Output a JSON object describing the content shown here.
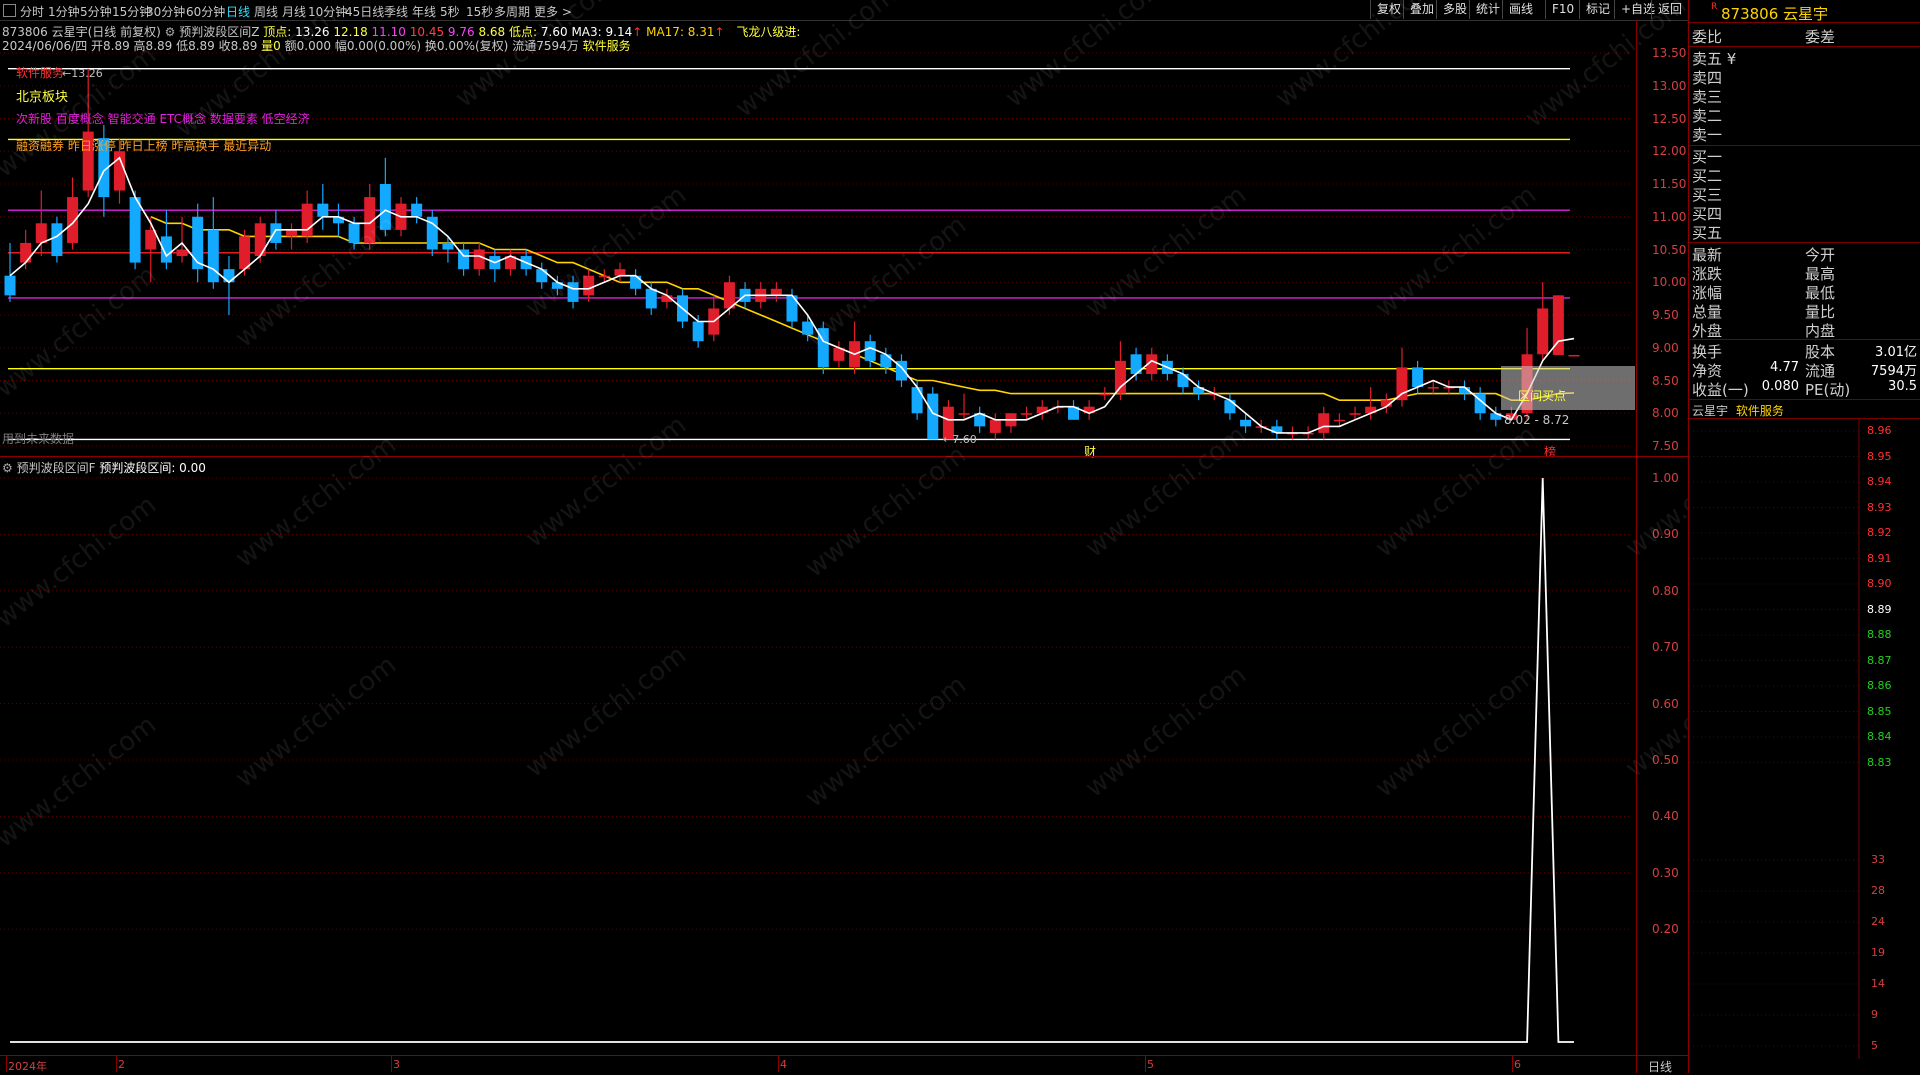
{
  "toolbar": {
    "timeframes": [
      "分时",
      "1分钟",
      "5分钟",
      "15分钟",
      "30分钟",
      "60分钟",
      "日线",
      "周线",
      "月线",
      "10分钟",
      "45日线",
      "季线",
      "年线",
      "5秒",
      "15秒",
      "多周期",
      "更多 >"
    ],
    "active": "日线",
    "right_buttons": [
      "复权",
      "叠加",
      "多股",
      "统计",
      "画线",
      "F10",
      "标记",
      "+自选",
      "返回"
    ]
  },
  "stock": {
    "code": "873806",
    "name": "云星宇",
    "title_line": "873806 云星宇(日线 前复权)",
    "indicator_name": "预判波段区间Z",
    "peak_label": "顶点:",
    "peak_values": [
      "13.26",
      "12.18",
      "11.10",
      "10.45",
      "9.76",
      "8.68"
    ],
    "low_label": "低点:",
    "low_value": "7.60",
    "ma3": "MA3: 9.14",
    "ma17": "MA17: 8.31",
    "flag": "飞龙八级进:",
    "date_line": "2024/06/06/四 开8.89 高8.89 低8.89 收8.89",
    "vol_label": "量0",
    "amount": "额0.000",
    "amp": "幅0.00(0.00%)",
    "turnover": "换0.00%(复权)",
    "float": "流通7594万",
    "sector": "软件服务"
  },
  "annotations": {
    "software": "软件服务",
    "peak_marker": "13.26",
    "beijing": "北京板块",
    "concepts": "次新股 百度概念 智能交通 ETC概念 数据要素 低空经济",
    "news": "融资融券 昨日涨停 昨日上榜 昨高换手 最近异动",
    "low_marker": "7.60",
    "buy_zone": "区间买点",
    "range_text": "8.02 - 8.72",
    "future": "用到未来数据",
    "cai": "财",
    "bang": "榜"
  },
  "sub_indicator": {
    "title": "预判波段区间F",
    "label": "预判波段区间: 0.00"
  },
  "date_axis": [
    "2024年",
    "2",
    "3",
    "4",
    "5",
    "6"
  ],
  "period_label": "日线",
  "right_panel": {
    "header_flag": "R",
    "header": "873806 云星宇",
    "weibi": "委比",
    "weicha": "委差",
    "asks": [
      "卖五 ¥",
      "卖四",
      "卖三",
      "卖二",
      "卖一"
    ],
    "bids": [
      "买一",
      "买二",
      "买三",
      "买四",
      "买五"
    ],
    "stats_left": [
      "最新",
      "涨跌",
      "涨幅",
      "总量",
      "外盘"
    ],
    "stats_right": [
      "今开",
      "最高",
      "最低",
      "量比",
      "内盘"
    ],
    "fund": [
      {
        "label": "换手",
        "label2": "股本",
        "value2": "3.01亿"
      },
      {
        "label": "净资",
        "value": "4.77",
        "label2": "流通",
        "value2": "7594万"
      },
      {
        "label": "收益(一)",
        "value": "0.080",
        "label2": "PE(动)",
        "value2": "30.5"
      }
    ],
    "mini_title": "云星宇",
    "mini_sector": "软件服务",
    "mini_prices": [
      "8.96",
      "8.95",
      "8.94",
      "8.93",
      "8.92",
      "8.91",
      "8.90",
      "8.89",
      "8.88",
      "8.87",
      "8.86",
      "8.85",
      "8.84",
      "8.83"
    ],
    "mini_vols": [
      "33",
      "28",
      "24",
      "19",
      "14",
      "9",
      "5"
    ]
  },
  "watermark": "www.cfchi.com",
  "colors": {
    "up": "#e01e2b",
    "down": "#12a9ff",
    "ma3": "#ffffff",
    "ma17": "#ffd400",
    "price_axis": "#d24040",
    "magenta": "#e020e0",
    "yellow": "#ffff00",
    "red_line": "#ff3030"
  },
  "chart_data": {
    "type": "candlestick",
    "y_axis_labels": [
      "13.50",
      "13.00",
      "12.50",
      "12.00",
      "11.50",
      "11.00",
      "10.50",
      "10.00",
      "9.50",
      "9.00",
      "8.50",
      "8.00",
      "7.50"
    ],
    "ylim": [
      7.35,
      13.6
    ],
    "horizontal_levels": [
      {
        "value": 13.26,
        "color": "white"
      },
      {
        "value": 12.18,
        "color": "yellow"
      },
      {
        "value": 11.1,
        "color": "magenta"
      },
      {
        "value": 10.45,
        "color": "red"
      },
      {
        "value": 9.76,
        "color": "magenta"
      },
      {
        "value": 8.68,
        "color": "yellow"
      },
      {
        "value": 7.6,
        "color": "white"
      }
    ],
    "candles": [
      [
        10.1,
        9.8,
        10.6,
        9.7
      ],
      [
        10.3,
        10.6,
        10.8,
        10.2
      ],
      [
        10.6,
        10.9,
        11.4,
        10.4
      ],
      [
        10.9,
        10.4,
        11.0,
        10.3
      ],
      [
        10.6,
        11.3,
        11.6,
        10.5
      ],
      [
        11.4,
        12.3,
        13.26,
        11.3
      ],
      [
        12.2,
        11.3,
        12.4,
        11.0
      ],
      [
        11.4,
        12.0,
        12.2,
        11.2
      ],
      [
        11.3,
        10.3,
        11.4,
        10.2
      ],
      [
        10.5,
        10.8,
        11.0,
        10.0
      ],
      [
        10.7,
        10.3,
        11.1,
        10.2
      ],
      [
        10.4,
        10.5,
        11.0,
        10.3
      ],
      [
        11.0,
        10.2,
        11.2,
        10.0
      ],
      [
        10.8,
        10.0,
        11.3,
        9.9
      ],
      [
        10.2,
        10.0,
        10.4,
        9.5
      ],
      [
        10.2,
        10.7,
        10.8,
        10.1
      ],
      [
        10.4,
        10.9,
        11.0,
        10.3
      ],
      [
        10.9,
        10.6,
        11.1,
        10.5
      ],
      [
        10.7,
        10.8,
        10.9,
        10.5
      ],
      [
        10.7,
        11.2,
        11.4,
        10.6
      ],
      [
        11.2,
        11.0,
        11.5,
        10.8
      ],
      [
        11.0,
        10.9,
        11.2,
        10.7
      ],
      [
        10.9,
        10.6,
        11.0,
        10.5
      ],
      [
        10.6,
        11.3,
        11.5,
        10.5
      ],
      [
        11.5,
        10.8,
        11.9,
        10.7
      ],
      [
        10.8,
        11.2,
        11.3,
        10.7
      ],
      [
        11.2,
        11.0,
        11.3,
        10.9
      ],
      [
        11.0,
        10.5,
        11.1,
        10.4
      ],
      [
        10.6,
        10.5,
        10.7,
        10.3
      ],
      [
        10.5,
        10.2,
        10.6,
        10.1
      ],
      [
        10.2,
        10.5,
        10.6,
        10.1
      ],
      [
        10.4,
        10.2,
        10.5,
        10.0
      ],
      [
        10.2,
        10.4,
        10.5,
        10.1
      ],
      [
        10.4,
        10.2,
        10.5,
        10.1
      ],
      [
        10.2,
        10.0,
        10.3,
        9.9
      ],
      [
        10.0,
        9.9,
        10.1,
        9.8
      ],
      [
        10.0,
        9.7,
        10.1,
        9.6
      ],
      [
        9.8,
        10.1,
        10.2,
        9.7
      ],
      [
        10.1,
        10.1,
        10.2,
        10.0
      ],
      [
        10.1,
        10.2,
        10.3,
        10.0
      ],
      [
        10.1,
        9.9,
        10.2,
        9.8
      ],
      [
        9.9,
        9.6,
        10.0,
        9.5
      ],
      [
        9.7,
        9.8,
        9.9,
        9.6
      ],
      [
        9.8,
        9.4,
        9.9,
        9.3
      ],
      [
        9.4,
        9.1,
        9.5,
        9.0
      ],
      [
        9.2,
        9.6,
        9.8,
        9.1
      ],
      [
        9.6,
        10.0,
        10.1,
        9.5
      ],
      [
        9.9,
        9.7,
        10.0,
        9.6
      ],
      [
        9.7,
        9.9,
        10.0,
        9.6
      ],
      [
        9.8,
        9.9,
        10.0,
        9.7
      ],
      [
        9.8,
        9.4,
        9.9,
        9.3
      ],
      [
        9.4,
        9.2,
        9.5,
        9.1
      ],
      [
        9.3,
        8.7,
        9.4,
        8.6
      ],
      [
        8.8,
        9.0,
        9.1,
        8.7
      ],
      [
        8.7,
        9.1,
        9.4,
        8.6
      ],
      [
        9.1,
        8.8,
        9.2,
        8.7
      ],
      [
        8.9,
        8.7,
        9.0,
        8.6
      ],
      [
        8.8,
        8.5,
        8.9,
        8.4
      ],
      [
        8.4,
        8.0,
        8.5,
        7.9
      ],
      [
        8.3,
        7.6,
        8.4,
        7.6
      ],
      [
        7.6,
        8.1,
        8.2,
        7.6
      ],
      [
        8.0,
        8.0,
        8.3,
        7.9
      ],
      [
        8.0,
        7.8,
        8.1,
        7.7
      ],
      [
        7.7,
        7.9,
        8.0,
        7.6
      ],
      [
        7.8,
        8.0,
        8.0,
        7.7
      ],
      [
        8.0,
        8.0,
        8.1,
        7.9
      ],
      [
        8.0,
        8.1,
        8.2,
        7.9
      ],
      [
        8.1,
        8.1,
        8.2,
        8.0
      ],
      [
        8.1,
        7.9,
        8.2,
        7.9
      ],
      [
        8.0,
        8.1,
        8.2,
        7.9
      ],
      [
        8.3,
        8.3,
        8.4,
        8.2
      ],
      [
        8.3,
        8.8,
        9.1,
        8.2
      ],
      [
        8.9,
        8.6,
        9.0,
        8.5
      ],
      [
        8.6,
        8.9,
        9.0,
        8.5
      ],
      [
        8.8,
        8.6,
        8.9,
        8.5
      ],
      [
        8.6,
        8.4,
        8.7,
        8.3
      ],
      [
        8.4,
        8.3,
        8.5,
        8.2
      ],
      [
        8.3,
        8.3,
        8.4,
        8.2
      ],
      [
        8.2,
        8.0,
        8.3,
        7.9
      ],
      [
        7.9,
        7.8,
        8.0,
        7.7
      ],
      [
        7.8,
        7.8,
        7.9,
        7.7
      ],
      [
        7.8,
        7.7,
        7.9,
        7.6
      ],
      [
        7.7,
        7.7,
        7.8,
        7.6
      ],
      [
        7.7,
        7.7,
        7.8,
        7.6
      ],
      [
        7.7,
        8.0,
        8.1,
        7.6
      ],
      [
        7.9,
        7.9,
        8.0,
        7.8
      ],
      [
        8.0,
        8.0,
        8.1,
        7.9
      ],
      [
        8.0,
        8.1,
        8.4,
        7.9
      ],
      [
        8.1,
        8.2,
        8.3,
        8.0
      ],
      [
        8.2,
        8.7,
        9.0,
        8.1
      ],
      [
        8.7,
        8.4,
        8.8,
        8.3
      ],
      [
        8.4,
        8.4,
        8.5,
        8.3
      ],
      [
        8.4,
        8.4,
        8.5,
        8.3
      ],
      [
        8.4,
        8.3,
        8.5,
        8.2
      ],
      [
        8.3,
        8.0,
        8.4,
        7.9
      ],
      [
        8.0,
        7.9,
        8.1,
        7.8
      ],
      [
        7.9,
        8.0,
        8.1,
        7.9
      ],
      [
        8.0,
        8.9,
        9.3,
        7.9
      ],
      [
        8.9,
        9.6,
        10.0,
        8.8
      ],
      [
        8.89,
        9.8,
        9.8,
        8.89
      ],
      [
        8.89,
        8.89,
        8.89,
        8.89
      ]
    ],
    "ma3": [
      10.1,
      10.3,
      10.6,
      10.7,
      10.9,
      11.2,
      11.7,
      11.9,
      11.3,
      10.9,
      10.4,
      10.6,
      10.3,
      10.2,
      10.0,
      10.2,
      10.4,
      10.8,
      10.8,
      10.8,
      11.0,
      11.0,
      10.9,
      10.9,
      11.1,
      11.0,
      11.0,
      10.9,
      10.7,
      10.4,
      10.4,
      10.3,
      10.4,
      10.3,
      10.2,
      10.0,
      9.9,
      9.9,
      10.0,
      10.1,
      10.1,
      9.9,
      9.8,
      9.6,
      9.4,
      9.4,
      9.6,
      9.8,
      9.8,
      9.8,
      9.8,
      9.5,
      9.1,
      9.0,
      8.9,
      9.0,
      8.9,
      8.7,
      8.4,
      8.0,
      7.9,
      7.9,
      8.0,
      7.9,
      7.9,
      7.9,
      8.0,
      8.1,
      8.1,
      8.0,
      8.1,
      8.4,
      8.6,
      8.8,
      8.7,
      8.6,
      8.4,
      8.3,
      8.2,
      8.0,
      7.8,
      7.7,
      7.7,
      7.7,
      7.8,
      7.8,
      7.9,
      8.0,
      8.1,
      8.3,
      8.4,
      8.5,
      8.4,
      8.4,
      8.2,
      8.0,
      7.9,
      8.3,
      8.8,
      9.1,
      9.14
    ],
    "ma17": [
      null,
      null,
      null,
      null,
      null,
      null,
      null,
      null,
      null,
      11.0,
      10.9,
      10.9,
      10.8,
      10.8,
      10.8,
      10.7,
      10.7,
      10.7,
      10.7,
      10.7,
      10.7,
      10.7,
      10.6,
      10.6,
      10.6,
      10.6,
      10.6,
      10.6,
      10.6,
      10.6,
      10.6,
      10.5,
      10.5,
      10.5,
      10.4,
      10.3,
      10.3,
      10.2,
      10.1,
      10.0,
      10.0,
      10.0,
      10.0,
      9.9,
      9.9,
      9.8,
      9.7,
      9.6,
      9.5,
      9.4,
      9.3,
      9.2,
      9.1,
      9.0,
      8.9,
      8.8,
      8.7,
      8.6,
      8.5,
      8.5,
      8.45,
      8.4,
      8.35,
      8.35,
      8.3,
      8.3,
      8.3,
      8.3,
      8.3,
      8.3,
      8.3,
      8.3,
      8.3,
      8.3,
      8.3,
      8.3,
      8.3,
      8.3,
      8.3,
      8.3,
      8.3,
      8.3,
      8.3,
      8.3,
      8.3,
      8.2,
      8.2,
      8.2,
      8.2,
      8.25,
      8.3,
      8.3,
      8.3,
      8.3,
      8.3,
      8.3,
      8.2,
      8.2,
      8.25,
      8.3,
      8.31
    ],
    "sub_series": {
      "ylim": [
        0,
        1.05
      ],
      "y_axis_labels": [
        "1.00",
        "0.90",
        "0.80",
        "0.70",
        "0.60",
        "0.50",
        "0.40",
        "0.30",
        "0.20"
      ],
      "spike_index": 98,
      "spike_value": 1.0
    }
  }
}
